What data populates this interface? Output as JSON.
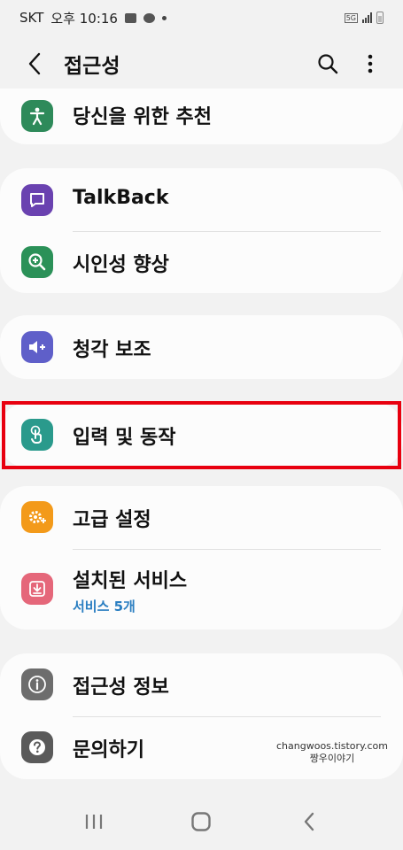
{
  "status_bar": {
    "carrier": "SKT",
    "time": "오후 10:16",
    "network_badge": "5G"
  },
  "header": {
    "title": "접근성"
  },
  "items": {
    "recommended": {
      "label": "당신을 위한 추천",
      "icon": "accessibility-person-icon",
      "color": "#2e8a5a"
    },
    "talkback": {
      "label": "TalkBack",
      "icon": "chat-icon",
      "color": "#6a42b0"
    },
    "visibility": {
      "label": "시인성 향상",
      "icon": "magnifier-plus-icon",
      "color": "#2b9158"
    },
    "hearing": {
      "label": "청각 보조",
      "icon": "volume-icon",
      "color": "#5f5fc9"
    },
    "interaction": {
      "label": "입력 및 동작",
      "icon": "touch-hand-icon",
      "color": "#2a9a8c"
    },
    "advanced": {
      "label": "고급 설정",
      "icon": "gear-plus-icon",
      "color": "#f39a1a"
    },
    "installed": {
      "label": "설치된 서비스",
      "sub": "서비스 5개",
      "icon": "download-icon",
      "color": "#e5677a"
    },
    "about": {
      "label": "접근성 정보",
      "icon": "info-icon",
      "color": "#6d6d6d"
    },
    "contact": {
      "label": "문의하기",
      "icon": "question-icon",
      "color": "#5a5a5a"
    }
  },
  "watermark": {
    "line1": "changwoos.tistory.com",
    "line2": "짱우이야기"
  },
  "highlight_color": "#e8000f"
}
